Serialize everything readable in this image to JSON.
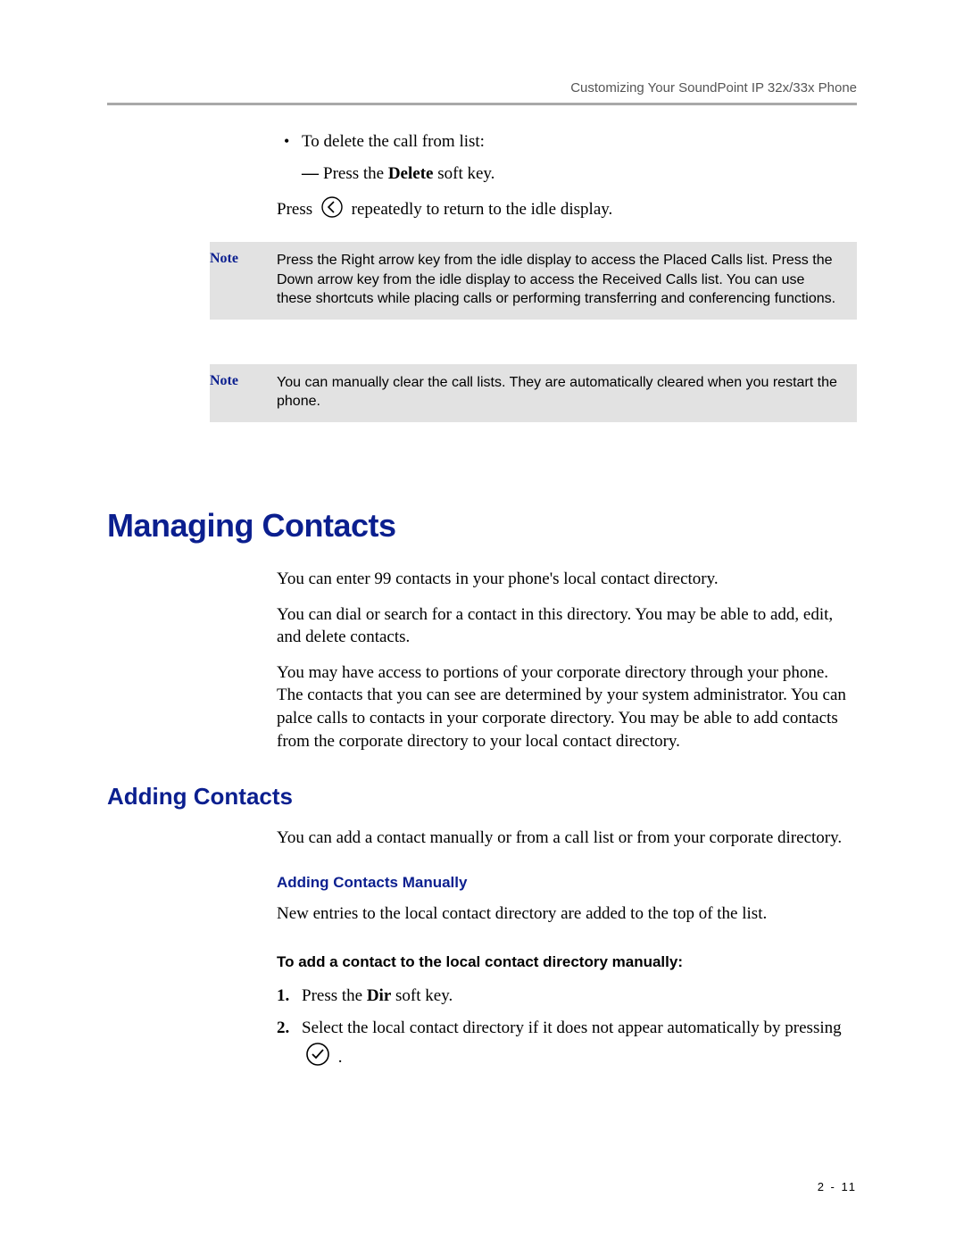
{
  "header": {
    "running_head": "Customizing Your SoundPoint IP 32x/33x Phone"
  },
  "intro": {
    "bullet1": "To delete the call from list:",
    "bullet2_pre": "Press the ",
    "bullet2_soft": "Delete",
    "bullet2_post": " soft key.",
    "press_pre": "Press ",
    "press_post": " repeatedly to return to the idle display."
  },
  "notes": {
    "label": "Note",
    "note1": "Press the Right arrow key from the idle display to access the Placed Calls list. Press the Down arrow key from the idle display to access the Received Calls list. You can use these shortcuts while placing calls or performing transferring and conferencing functions.",
    "note2": "You can manually clear the call lists. They are automatically cleared when you restart the phone."
  },
  "managing": {
    "title": "Managing Contacts",
    "p1": "You can enter 99 contacts in your phone's local contact directory.",
    "p2": "You can dial or search for a contact in this directory. You may be able to add, edit, and delete contacts.",
    "p3": "You may have access to portions of your corporate directory through your phone. The contacts that you can see are determined by your system administrator. You can palce calls to contacts in your corporate directory. You may be able to add contacts from the corporate directory to your local contact directory."
  },
  "adding": {
    "title": "Adding Contacts",
    "p1": "You can add a contact manually or from a call list or from your corporate directory.",
    "manual_head": "Adding Contacts Manually",
    "manual_p1": "New entries to the local contact directory are added to the top of the list.",
    "task_head": "To add a contact to the local contact directory manually:",
    "step1_num": "1.",
    "step1_pre": "Press the ",
    "step1_soft": "Dir",
    "step1_post": " soft key.",
    "step2_num": "2.",
    "step2_pre": "Select the local contact directory if it does not appear automatically by pressing ",
    "step2_post": " ."
  },
  "footer": {
    "page_num": "2 - 11"
  }
}
